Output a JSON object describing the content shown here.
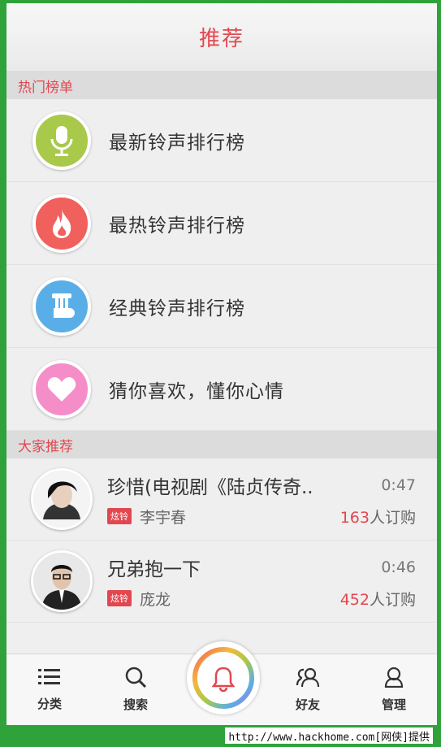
{
  "header": {
    "title": "推荐"
  },
  "sections": {
    "hot": "热门榜单",
    "recommend": "大家推荐"
  },
  "rank_items": [
    {
      "label": "最新铃声排行榜",
      "icon": "microphone-icon",
      "color": "#a8c94a"
    },
    {
      "label": "最热铃声排行榜",
      "icon": "flame-icon",
      "color": "#f0605c"
    },
    {
      "label": "经典铃声排行榜",
      "icon": "instrument-icon",
      "color": "#5aaee8"
    },
    {
      "label": "猜你喜欢，懂你心情",
      "icon": "heart-icon",
      "color": "#f58dc8"
    }
  ],
  "songs": [
    {
      "title": "珍惜(电视剧《陆贞传奇..",
      "duration": "0:47",
      "tag": "炫铃",
      "singer": "李宇春",
      "subs_num": "163",
      "subs_suffix": "人订购"
    },
    {
      "title": "兄弟抱一下",
      "duration": "0:46",
      "tag": "炫铃",
      "singer": "庞龙",
      "subs_num": "452",
      "subs_suffix": "人订购"
    }
  ],
  "nav": [
    {
      "label": "分类",
      "icon": "list-icon"
    },
    {
      "label": "搜索",
      "icon": "search-icon"
    },
    {
      "label": "",
      "icon": "bell-icon"
    },
    {
      "label": "好友",
      "icon": "friends-icon"
    },
    {
      "label": "管理",
      "icon": "user-icon"
    }
  ],
  "watermark": "http://www.hackhome.com[网侠]提供"
}
